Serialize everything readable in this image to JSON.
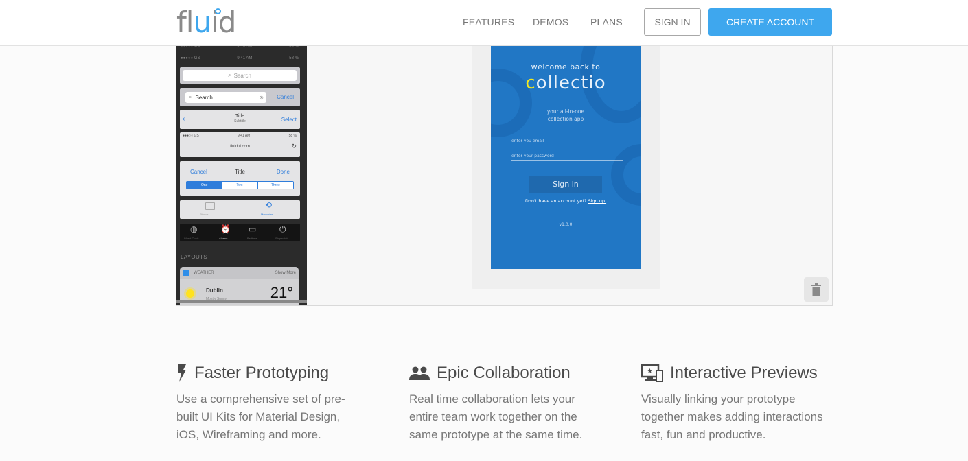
{
  "header": {
    "logo": {
      "part1": "fl",
      "part2": "u",
      "part3": "id"
    },
    "nav": [
      {
        "label": "FEATURES"
      },
      {
        "label": "DEMOS"
      },
      {
        "label": "PLANS"
      }
    ],
    "sign_in": "SIGN IN",
    "create_account": "CREATE ACCOUNT",
    "accent_color": "#3ea7ee"
  },
  "ios_kit": {
    "status_time": "9:41 AM",
    "status_carrier": "●●●○○ GS",
    "status_battery": "58 %",
    "search_placeholder": "Search",
    "search_value": "Search",
    "cancel": "Cancel",
    "nav_title": "Title",
    "nav_subtitle": "Subtitle",
    "nav_select": "Select",
    "url": "fluidui.com",
    "modal_cancel": "Cancel",
    "modal_title": "Title",
    "modal_done": "Done",
    "segments": [
      "One",
      "Two",
      "Three"
    ],
    "tabs": [
      "Photos",
      "Memories"
    ],
    "clock_tabs": [
      "World Clock",
      "Alarms",
      "Bedtime",
      "Stopwatch"
    ],
    "section_label": "LAYOUTS",
    "widget_title": "WEATHER",
    "widget_more": "Show More",
    "city": "Dublin",
    "city_sub": "Mostly Sunny",
    "temperature": "21°"
  },
  "phone": {
    "welcome": "welcome back to",
    "brand_first": "c",
    "brand_rest": "ollectio",
    "tagline1": "your all-in-one",
    "tagline2": "collection app",
    "email_placeholder": "enter you email",
    "password_placeholder": "enter your password",
    "signin": "Sign in",
    "no_account": "Don't have an account yet?",
    "signup": "Sign up.",
    "version": "v1.0.0",
    "bg_color": "#2177c5"
  },
  "features": [
    {
      "icon": "lightning-icon",
      "title": "Faster Prototyping",
      "text": "Use a comprehensive set of pre-built UI Kits for Material Design, iOS, Wireframing and more."
    },
    {
      "icon": "people-icon",
      "title": "Epic Collaboration",
      "text": "Real time collaboration lets your entire team work together on the same prototype at the same time."
    },
    {
      "icon": "devices-icon",
      "title": "Interactive Previews",
      "text": "Visually linking your prototype together makes adding interactions fast, fun and productive."
    }
  ]
}
